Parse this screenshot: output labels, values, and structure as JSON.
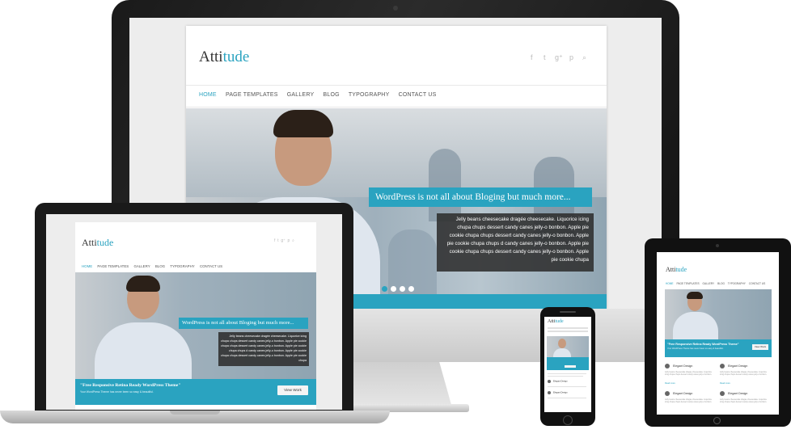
{
  "brand": {
    "logo_main": "Atti",
    "logo_accent": "tude",
    "accent_color": "#2aa3c0"
  },
  "nav": {
    "home": "HOME",
    "page_templates": "PAGE TEMPLATES",
    "gallery": "GALLERY",
    "blog": "BLOG",
    "typography": "TYPOGRAPHY",
    "contact": "CONTACT US"
  },
  "social_icons": [
    "facebook-icon",
    "twitter-icon",
    "google-plus-icon",
    "pinterest-icon",
    "search-icon"
  ],
  "social_glyphs": [
    "f",
    "t",
    "g⁺",
    "p",
    "⌕"
  ],
  "hero": {
    "title": "WordPress is not all about Bloging but much more...",
    "text": "Jelly beans cheesecake dragée cheesecake. Liquorice icing chupa chups dessert candy canes jelly-o bonbon. Apple pie cookie chupa chups dessert candy canes jelly-o bonbon. Apple pie cookie chupa chups d candy canes jelly-o bonbon. Apple pie cookie chupa chups dessert candy canes jelly-o bonbon. Apple pie cookie chupa"
  },
  "promo": {
    "title": "\"Free Responsive Retina Ready WordPress Theme\"",
    "subtitle": "Your WordPress Theme has never been so easy & beautiful.",
    "button": "View Work"
  },
  "items": {
    "elegant_design": "Elegant Design",
    "more_link": "Read more",
    "item_text": "Jelly beans cheesecake dragée cheesecake. Liquorice icing chupa chups dessert candy canes jelly-o bonbon."
  },
  "monitor_logo": ""
}
